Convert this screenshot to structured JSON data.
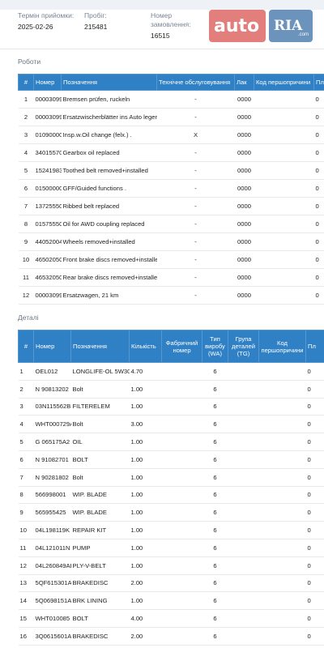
{
  "header": {
    "fields": [
      {
        "label": "Термін прийомки:",
        "value": "2025-02-26"
      },
      {
        "label": "Пробіг:",
        "value": "215481"
      },
      {
        "label": "Номер замовлення:",
        "value": "16515"
      }
    ],
    "watermark": {
      "auto": "auto",
      "ria": "RIA",
      "com": ".com"
    }
  },
  "works": {
    "title": "Роботи",
    "columns": [
      "#",
      "Номер",
      "Позначення",
      "Технічне обслуговування",
      "Лак",
      "Код першопричини",
      "Пл"
    ],
    "rows": [
      {
        "n": "1",
        "num": "000030999",
        "desc": "Bremsen prüfen, ruckeln",
        "to": "-",
        "lak": "0000",
        "kod": "",
        "pl": "0"
      },
      {
        "n": "2",
        "num": "000030999",
        "desc": "Ersatzwischerblätter ins Auto legen",
        "to": "-",
        "lak": "0000",
        "kod": "",
        "pl": "0"
      },
      {
        "n": "3",
        "num": "010900000",
        "desc": "Insp.w.Oil change (felx.) .",
        "to": "X",
        "lak": "0000",
        "kod": "",
        "pl": "0"
      },
      {
        "n": "4",
        "num": "340155700",
        "desc": "Gearbox oil replaced",
        "to": "-",
        "lak": "0000",
        "kod": "",
        "pl": "0"
      },
      {
        "n": "5",
        "num": "152419830",
        "desc": "Toothed belt removed+installed",
        "to": "-",
        "lak": "0000",
        "kod": "",
        "pl": "0"
      },
      {
        "n": "6",
        "num": "015000000",
        "desc": "GFF/Guided functions .",
        "to": "-",
        "lak": "0000",
        "kod": "",
        "pl": "0"
      },
      {
        "n": "7",
        "num": "137255500",
        "desc": "Ribbed belt replaced",
        "to": "-",
        "lak": "0000",
        "kod": "",
        "pl": "0"
      },
      {
        "n": "8",
        "num": "015755500",
        "desc": "Oil for AWD coupling replaced",
        "to": "-",
        "lak": "0000",
        "kod": "",
        "pl": "0"
      },
      {
        "n": "9",
        "num": "440520040",
        "desc": "Wheels removed+installed",
        "to": "-",
        "lak": "0000",
        "kod": "",
        "pl": "0"
      },
      {
        "n": "10",
        "num": "465020500",
        "desc": "Front brake discs removed+installed",
        "to": "-",
        "lak": "0000",
        "kod": "",
        "pl": "0"
      },
      {
        "n": "11",
        "num": "465320500",
        "desc": "Rear brake discs removed+installed",
        "to": "-",
        "lak": "0000",
        "kod": "",
        "pl": "0"
      },
      {
        "n": "12",
        "num": "000030999",
        "desc": "Ersatzwagen, 21 km",
        "to": "-",
        "lak": "0000",
        "kod": "",
        "pl": "0"
      }
    ]
  },
  "parts": {
    "title": "Деталі",
    "columns": [
      "#",
      "Номер",
      "Позначення",
      "Кількість",
      "Фабричний номер",
      "Тип виробу (WA)",
      "Група деталей (TG)",
      "Код першопричини",
      "Пл"
    ],
    "rows": [
      {
        "n": "1",
        "num": "OEL012",
        "desc": "LONGLIFE-OL 5W30",
        "qty": "4.70",
        "fab": "",
        "wa": "6",
        "tg": "",
        "kod": "",
        "pl": "0"
      },
      {
        "n": "2",
        "num": "N 90813202",
        "desc": "Bolt",
        "qty": "1.00",
        "fab": "",
        "wa": "6",
        "tg": "",
        "kod": "",
        "pl": "0"
      },
      {
        "n": "3",
        "num": "03N115562B",
        "desc": "FILTERELEM",
        "qty": "1.00",
        "fab": "",
        "wa": "6",
        "tg": "",
        "kod": "",
        "pl": "0"
      },
      {
        "n": "4",
        "num": "WHT000729A",
        "desc": "Bolt",
        "qty": "3.00",
        "fab": "",
        "wa": "6",
        "tg": "",
        "kod": "",
        "pl": "0"
      },
      {
        "n": "5",
        "num": "G 065175A2",
        "desc": "OIL",
        "qty": "1.00",
        "fab": "",
        "wa": "6",
        "tg": "",
        "kod": "",
        "pl": "0"
      },
      {
        "n": "6",
        "num": "N 91082701",
        "desc": "BOLT",
        "qty": "1.00",
        "fab": "",
        "wa": "6",
        "tg": "",
        "kod": "",
        "pl": "0"
      },
      {
        "n": "7",
        "num": "N 90281802",
        "desc": "Bolt",
        "qty": "1.00",
        "fab": "",
        "wa": "6",
        "tg": "",
        "kod": "",
        "pl": "0"
      },
      {
        "n": "8",
        "num": "566998001",
        "desc": "WIP. BLADE",
        "qty": "1.00",
        "fab": "",
        "wa": "6",
        "tg": "",
        "kod": "",
        "pl": "0"
      },
      {
        "n": "9",
        "num": "565955425",
        "desc": "WIP. BLADE",
        "qty": "1.00",
        "fab": "",
        "wa": "6",
        "tg": "",
        "kod": "",
        "pl": "0"
      },
      {
        "n": "10",
        "num": "04L198119K",
        "desc": "REPAIR KIT",
        "qty": "1.00",
        "fab": "",
        "wa": "6",
        "tg": "",
        "kod": "",
        "pl": "0"
      },
      {
        "n": "11",
        "num": "04L121011N",
        "desc": "PUMP",
        "qty": "1.00",
        "fab": "",
        "wa": "6",
        "tg": "",
        "kod": "",
        "pl": "0"
      },
      {
        "n": "12",
        "num": "04L260849AB",
        "desc": "PLY-V-BELT",
        "qty": "1.00",
        "fab": "",
        "wa": "6",
        "tg": "",
        "kod": "",
        "pl": "0"
      },
      {
        "n": "13",
        "num": "5QF615301A",
        "desc": "BRAKEDISC",
        "qty": "2.00",
        "fab": "",
        "wa": "6",
        "tg": "",
        "kod": "",
        "pl": "0"
      },
      {
        "n": "14",
        "num": "5Q0698151AJ",
        "desc": "BRK LINING",
        "qty": "1.00",
        "fab": "",
        "wa": "6",
        "tg": "",
        "kod": "",
        "pl": "0"
      },
      {
        "n": "15",
        "num": "WHT010085",
        "desc": "BOLT",
        "qty": "4.00",
        "fab": "",
        "wa": "6",
        "tg": "",
        "kod": "",
        "pl": "0"
      },
      {
        "n": "16",
        "num": "3Q0615601A",
        "desc": "BRAKEDISC",
        "qty": "2.00",
        "fab": "",
        "wa": "6",
        "tg": "",
        "kod": "",
        "pl": "0"
      }
    ]
  }
}
